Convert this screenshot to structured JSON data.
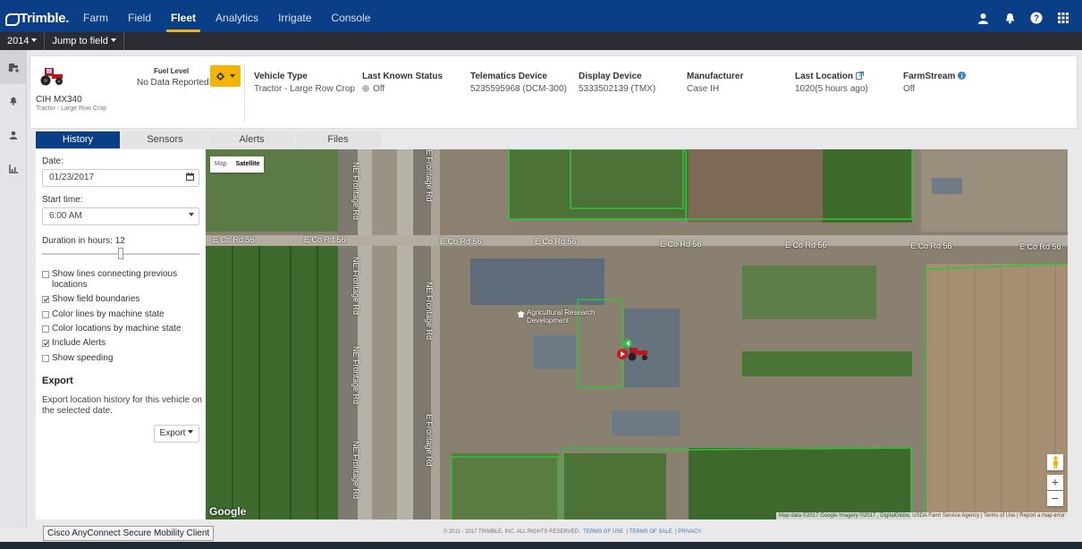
{
  "brand": "Trimble.",
  "nav": {
    "items": [
      {
        "label": "Farm",
        "active": false
      },
      {
        "label": "Field",
        "active": false
      },
      {
        "label": "Fleet",
        "active": true
      },
      {
        "label": "Analytics",
        "active": false
      },
      {
        "label": "Irrigate",
        "active": false
      },
      {
        "label": "Console",
        "active": false
      }
    ],
    "accent_color": "#f4b400",
    "bar_color": "#0a3f87"
  },
  "subbar": {
    "year": "2014",
    "jump": "Jump to field"
  },
  "vehicle": {
    "name": "CIH MX340",
    "type_short": "Tractor - Large Row Crop",
    "fuel_label": "Fuel Level",
    "fuel_value": "No Data Reported",
    "fields": [
      {
        "label": "Vehicle Type",
        "value": "Tractor - Large Row Crop"
      },
      {
        "label": "Last Known Status",
        "value": "Off"
      },
      {
        "label": "Telematics Device",
        "value": "5235595968 (DCM-300)"
      },
      {
        "label": "Display Device",
        "value": "5333502139 (TMX)"
      },
      {
        "label": "Manufacturer",
        "value": "Case IH"
      },
      {
        "label": "Last Location",
        "value": "1020(5 hours ago)"
      },
      {
        "label": "FarmStream",
        "value": "Off"
      }
    ]
  },
  "tabs": [
    "History",
    "Sensors",
    "Alerts",
    "Files"
  ],
  "history": {
    "date_label": "Date:",
    "date_value": "01/23/2017",
    "start_label": "Start time:",
    "start_value": "6:00 AM",
    "duration_label": "Duration in hours: 12",
    "duration_hours": 12,
    "options": [
      {
        "label": "Show lines connecting previous locations",
        "checked": false
      },
      {
        "label": "Show field boundaries",
        "checked": true
      },
      {
        "label": "Color lines by machine state",
        "checked": false
      },
      {
        "label": "Color locations by machine state",
        "checked": false
      },
      {
        "label": "Include Alerts",
        "checked": true
      },
      {
        "label": "Show speeding",
        "checked": false
      }
    ],
    "export_heading": "Export",
    "export_text": "Export location history for this vehicle on the selected date.",
    "export_button": "Export"
  },
  "map": {
    "types": [
      "Map",
      "Satellite"
    ],
    "selected_type": "Satellite",
    "road_labels": [
      "E Co Rd 56",
      "NE Frontage Rd",
      "E Frontage Rd",
      "NE Frontage Rd"
    ],
    "poi": "Agricultural Research Development",
    "attribution": "Map data ©2017 Google Imagery ©2017 , DigitalGlobe, USDA Farm Service Agency | Terms of Use | Report a map error",
    "google": "Google",
    "zoom_in": "+",
    "zoom_out": "−"
  },
  "footer": {
    "copyright": "© 2011 - 2017 TRIMBLE, INC. ALL RIGHTS RESERVED.",
    "links": [
      "TERMS OF USE",
      "TERMS OF SALE",
      "PRIVACY"
    ]
  },
  "tooltip": "Cisco AnyConnect Secure Mobility Client"
}
